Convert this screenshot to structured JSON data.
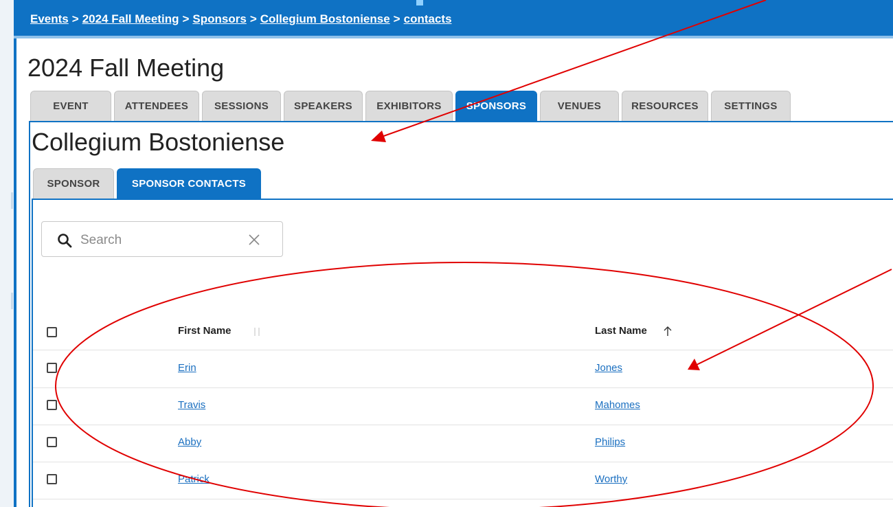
{
  "breadcrumb": {
    "items": [
      "Events",
      "2024 Fall Meeting",
      "Sponsors",
      "Collegium Bostoniense",
      "contacts"
    ],
    "separator": ">"
  },
  "page_title": "2024 Fall Meeting",
  "main_tabs": [
    "EVENT",
    "ATTENDEES",
    "SESSIONS",
    "SPEAKERS",
    "EXHIBITORS",
    "SPONSORS",
    "VENUES",
    "RESOURCES",
    "SETTINGS"
  ],
  "active_main_tab": "SPONSORS",
  "sponsor_title": "Collegium Bostoniense",
  "sub_tabs": [
    "SPONSOR",
    "SPONSOR CONTACTS"
  ],
  "active_sub_tab": "SPONSOR CONTACTS",
  "search": {
    "placeholder": "Search",
    "value": ""
  },
  "table": {
    "columns": [
      {
        "label": "First Name",
        "sort": "unsorted"
      },
      {
        "label": "Last Name",
        "sort": "ascending"
      }
    ],
    "rows": [
      {
        "first": "Erin",
        "last": "Jones"
      },
      {
        "first": "Travis",
        "last": "Mahomes"
      },
      {
        "first": "Abby",
        "last": "Philips"
      },
      {
        "first": "Patrick",
        "last": "Worthy"
      }
    ]
  },
  "colors": {
    "primary": "#0f72c4",
    "tab_inactive": "#dcdcdc",
    "link": "#1a6fc0",
    "annotation": "#e00000"
  },
  "icons": {
    "search": "search-icon",
    "clear": "close-icon",
    "sort_unsorted": "sort-both-icon",
    "sort_ascending": "arrow-up-icon"
  }
}
